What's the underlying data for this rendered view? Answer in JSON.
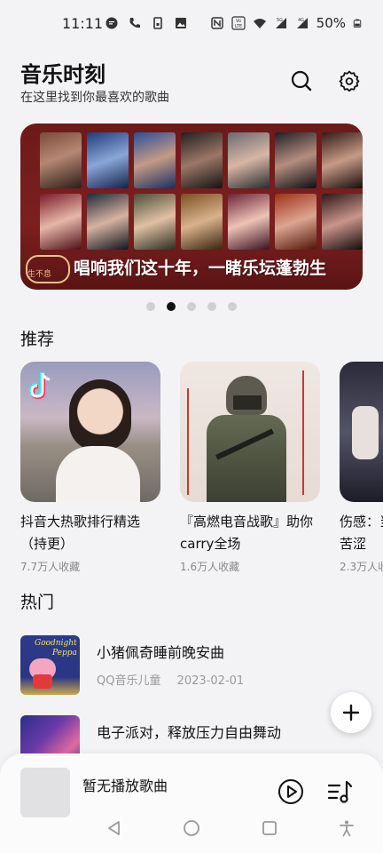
{
  "status_bar": {
    "time": "11:11",
    "battery": "50%",
    "net": [
      "5G",
      "4G"
    ]
  },
  "header": {
    "title": "音乐时刻",
    "subtitle": "在这里找到你最喜欢的歌曲"
  },
  "banner": {
    "slogan": "唱响我们这十年，一睹乐坛蓬勃生",
    "logo_text": "生不息",
    "page_count": 5,
    "active_page": 2
  },
  "recommend": {
    "title": "推荐",
    "cards": [
      {
        "title_line1": "抖音大热歌排行精选",
        "title_line2": "（持更）",
        "meta": "7.7万人收藏"
      },
      {
        "title_line1": "『高燃电音战歌』助你",
        "title_line2": "carry全场",
        "meta": "1.6万人收藏"
      },
      {
        "title_line1": "伤感：当",
        "title_line2": "苦涩",
        "meta": "2.3万人收藏"
      }
    ]
  },
  "hot": {
    "title": "热门",
    "items": [
      {
        "title": "小猪佩奇睡前晚安曲",
        "source": "QQ音乐儿童",
        "date": "2023-02-01",
        "thumb_text_1": "Goodnight",
        "thumb_text_2": "Peppa"
      },
      {
        "title": "电子派对，释放压力自由舞动",
        "source": "",
        "date": ""
      }
    ]
  },
  "player": {
    "title": "暂无播放歌曲"
  },
  "icons": [
    "search-icon",
    "settings-icon",
    "play-icon",
    "playlist-icon",
    "add-icon",
    "back-icon",
    "home-icon",
    "recents-icon",
    "accessibility-icon"
  ]
}
